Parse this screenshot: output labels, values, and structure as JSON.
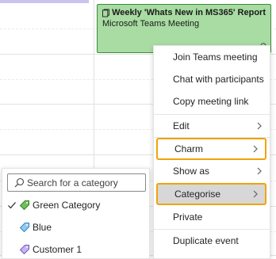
{
  "event": {
    "title": "Weekly 'Whats New in MS365' Report",
    "subtitle": "Microsoft Teams Meeting",
    "background": "#a8dca2",
    "border": "#3c8a3a"
  },
  "context_menu": {
    "items": [
      {
        "label": "Join Teams meeting",
        "has_submenu": false
      },
      {
        "label": "Chat with participants",
        "has_submenu": false
      },
      {
        "label": "Copy meeting link",
        "has_submenu": false
      },
      {
        "label": "Edit",
        "has_submenu": true
      },
      {
        "label": "Charm",
        "has_submenu": true,
        "highlighted": true
      },
      {
        "label": "Show as",
        "has_submenu": true
      },
      {
        "label": "Categorise",
        "has_submenu": true,
        "highlighted": true,
        "selected": true
      },
      {
        "label": "Private",
        "has_submenu": false
      },
      {
        "label": "Duplicate event",
        "has_submenu": false
      }
    ],
    "highlight_color": "#f0a30a"
  },
  "category_menu": {
    "search_placeholder": "Search for a category",
    "categories": [
      {
        "label": "Green Category",
        "color": "#6fbf5a",
        "checked": true
      },
      {
        "label": "Blue",
        "color": "#4aa0d8",
        "checked": false
      },
      {
        "label": "Customer 1",
        "color": "#9c7ad8",
        "checked": false
      }
    ]
  }
}
